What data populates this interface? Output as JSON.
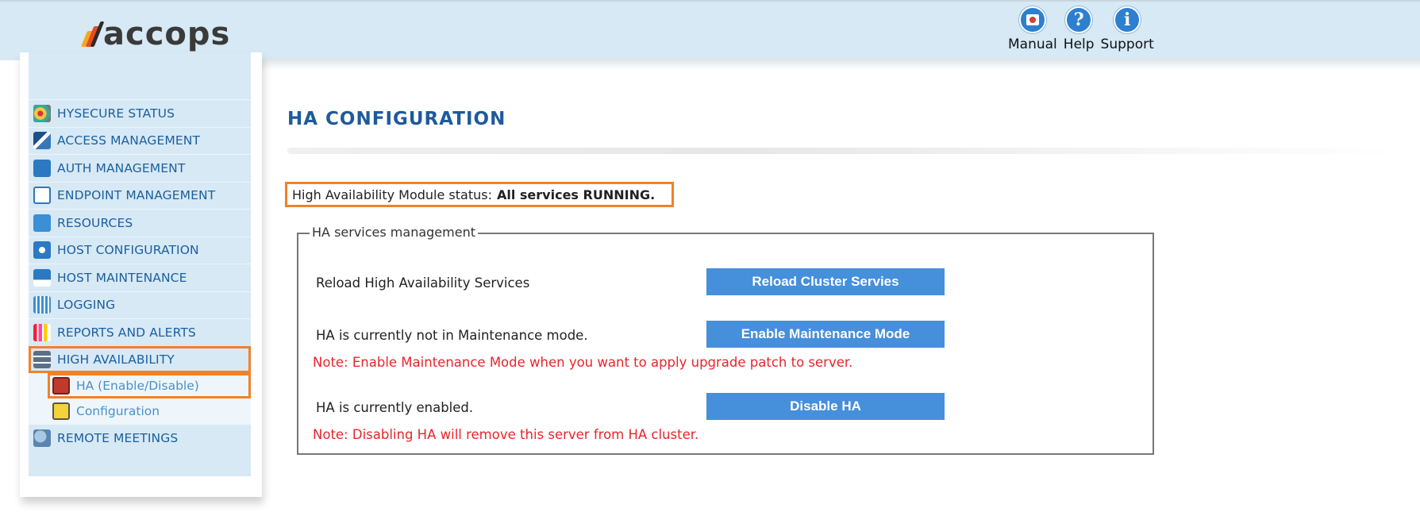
{
  "header": {
    "logo_text": "accops",
    "links": [
      {
        "label": "Manual",
        "icon": "manual-icon"
      },
      {
        "label": "Help",
        "icon": "help-icon"
      },
      {
        "label": "Support",
        "icon": "support-icon"
      }
    ],
    "help_glyph": "?",
    "support_glyph": "i"
  },
  "sidebar": {
    "items": [
      {
        "label": "HYSECURE STATUS",
        "icon": "status-icon"
      },
      {
        "label": "ACCESS MANAGEMENT",
        "icon": "access-icon"
      },
      {
        "label": "AUTH MANAGEMENT",
        "icon": "lock-icon"
      },
      {
        "label": "ENDPOINT MANAGEMENT",
        "icon": "scales-icon"
      },
      {
        "label": "RESOURCES",
        "icon": "resources-icon"
      },
      {
        "label": "HOST CONFIGURATION",
        "icon": "gear-icon"
      },
      {
        "label": "HOST MAINTENANCE",
        "icon": "cart-icon"
      },
      {
        "label": "LOGGING",
        "icon": "calendar-icon"
      },
      {
        "label": "REPORTS AND ALERTS",
        "icon": "bar-chart-icon"
      },
      {
        "label": "HIGH AVAILABILITY",
        "icon": "cluster-icon",
        "active": true
      },
      {
        "label": "REMOTE MEETINGS",
        "icon": "meeting-icon"
      }
    ],
    "submenu": [
      {
        "label": "HA (Enable/Disable)",
        "icon": "ha-enable-icon",
        "active": true
      },
      {
        "label": "Configuration",
        "icon": "config-icon"
      }
    ]
  },
  "main": {
    "title": "HA CONFIGURATION",
    "status_prefix": "High Availability Module status:",
    "status_value": "All services RUNNING.",
    "fieldset_legend": "HA services management",
    "rows": [
      {
        "text": "Reload High Availability Services",
        "button": "Reload Cluster Servies"
      },
      {
        "text": "HA is currently not in Maintenance mode.",
        "button": "Enable Maintenance Mode",
        "note": "Note: Enable Maintenance Mode when you want to apply upgrade patch to server."
      },
      {
        "text": "HA is currently enabled.",
        "button": "Disable HA",
        "note": "Note: Disabling HA will remove this server from HA cluster."
      }
    ]
  },
  "colors": {
    "accent_highlight": "#f08228",
    "button_bg": "#468fdb",
    "note_red": "#e8252b",
    "title_blue": "#1e5a9c"
  }
}
